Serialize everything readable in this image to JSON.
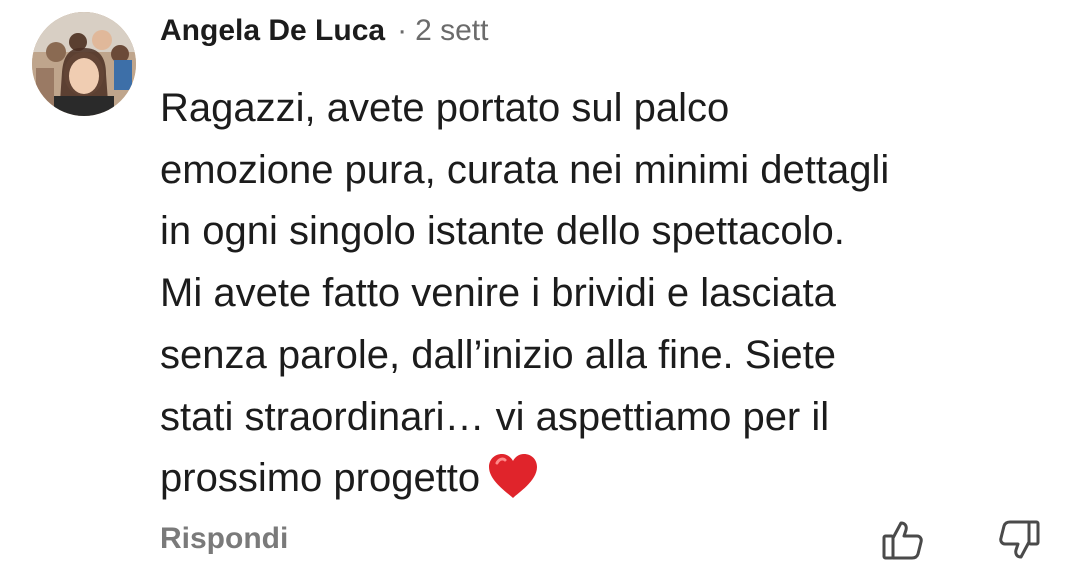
{
  "comment": {
    "author": "Angela De Luca",
    "separator": "·",
    "time": "2 sett",
    "lines": [
      "Ragazzi, avete portato sul palco",
      "emozione pura, curata nei minimi dettagli",
      "in ogni singolo istante dello spettacolo.",
      "Mi avete fatto venire i brividi e lasciata",
      "senza parole, dall’inizio alla fine. Siete",
      "stati straordinari… vi aspettiamo per il",
      "prossimo progetto"
    ],
    "emoji": "heart-icon"
  },
  "actions": {
    "reply_label": "Rispondi",
    "like_icon": "thumbs-up-icon",
    "dislike_icon": "thumbs-down-icon"
  },
  "colors": {
    "text": "#1c1c1c",
    "secondary": "#6b6b6b",
    "action": "#7a7a7a",
    "heart": "#e0242b"
  }
}
